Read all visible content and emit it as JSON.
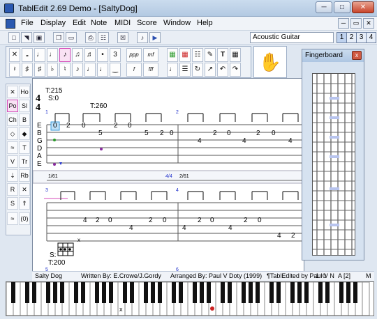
{
  "window": {
    "title": "TablEdit 2.69 Demo - [SaltyDog]"
  },
  "menu": [
    "File",
    "Display",
    "Edit",
    "Note",
    "MIDI",
    "Score",
    "Window",
    "Help"
  ],
  "instrument": "Acoustic Guitar",
  "tracks": [
    "1",
    "2",
    "3",
    "4"
  ],
  "score": {
    "tempo_1": "T:215",
    "swing": "S:0",
    "tempo_2": "T:260",
    "time_sig_top": "4",
    "time_sig_bottom": "4",
    "strings": [
      "E",
      "B",
      "G",
      "D",
      "A",
      "E"
    ],
    "measure_1": "1",
    "measure_2": "2",
    "measure_3": "3",
    "measure_4": "4",
    "measure_5": "5",
    "measure_6": "6",
    "ruler_left": "1/61",
    "ruler_mid": "4/4",
    "ruler_right": "2/61",
    "chord_swing": "S:",
    "chord_tempo": "T:200",
    "chord_mark": "x"
  },
  "fingerboard": {
    "title": "Fingerboard",
    "close": "x"
  },
  "status": {
    "title": "Salty Dog",
    "written": "Written By: E.Crowe/J.Gordy",
    "arranged": "Arranged By: Paul V Doty (1999)",
    "edited": "¶TablEdited by Paul V N",
    "position": "1:  0",
    "track": "A [2]",
    "mode": "M"
  }
}
